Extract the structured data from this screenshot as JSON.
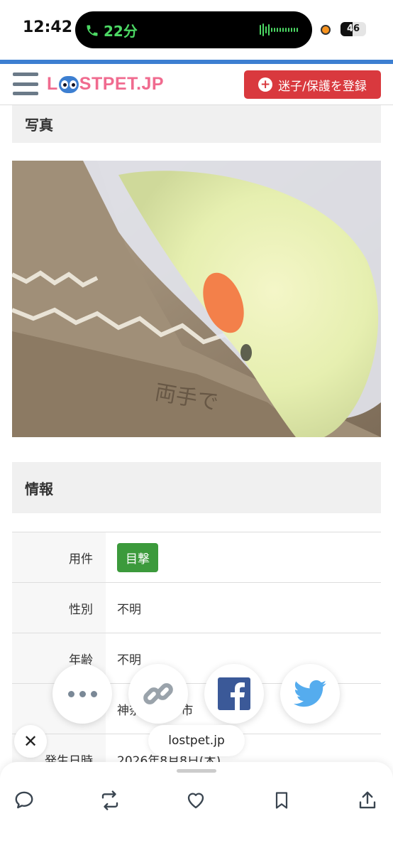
{
  "status_bar": {
    "time": "12:42",
    "call_duration": "22分",
    "battery_level": "46",
    "battery_fraction": 0.46
  },
  "header": {
    "logo_text_left": "L",
    "logo_text_right": "STPET.JP",
    "register_button_label": "迷子/保護を登録"
  },
  "photo_section": {
    "title": "写真"
  },
  "info_section": {
    "title": "情報",
    "rows": [
      {
        "label": "用件",
        "value": "目撃",
        "type": "badge"
      },
      {
        "label": "性別",
        "value": "不明"
      },
      {
        "label": "年齢",
        "value": "不明"
      },
      {
        "label": "",
        "value": "神奈川県 野市"
      },
      {
        "label": "発生日時",
        "value": "2026年8月8日(木)"
      }
    ]
  },
  "share_sheet": {
    "url": "lostpet.jp",
    "targets": [
      "more-options",
      "copy-link",
      "facebook",
      "twitter"
    ]
  },
  "bottom_actions": [
    "reply",
    "repost",
    "like",
    "bookmark",
    "share"
  ],
  "colors": {
    "brand_pink": "#f06b8f",
    "brand_blue": "#3d7fd1",
    "register_red": "#d9393e",
    "badge_green": "#3c9a3c",
    "call_green": "#4cd964"
  }
}
